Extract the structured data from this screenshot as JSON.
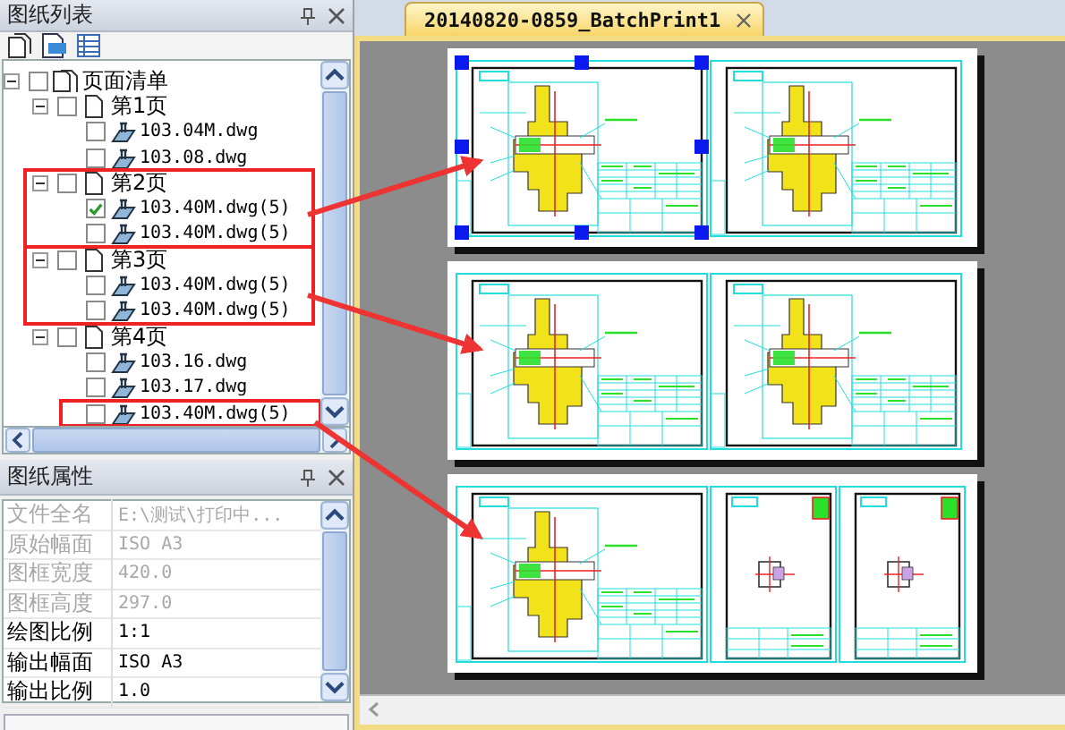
{
  "drawing_list_panel": {
    "title": "图纸列表",
    "tree": [
      {
        "label": "页面清单",
        "kind": "root",
        "expanded": true,
        "checked": false,
        "highlighted": false,
        "children": [
          {
            "label": "第1页",
            "kind": "page",
            "expanded": true,
            "checked": false,
            "highlighted": false,
            "children": [
              {
                "label": "103.04M.dwg",
                "kind": "file",
                "checked": false,
                "highlighted": false
              },
              {
                "label": "103.08.dwg",
                "kind": "file",
                "checked": false,
                "highlighted": false
              }
            ]
          },
          {
            "label": "第2页",
            "kind": "page",
            "expanded": true,
            "checked": false,
            "highlighted": true,
            "children": [
              {
                "label": "103.40M.dwg(5)",
                "kind": "file",
                "checked": true,
                "highlighted": false
              },
              {
                "label": "103.40M.dwg(5)",
                "kind": "file",
                "checked": false,
                "highlighted": false
              }
            ]
          },
          {
            "label": "第3页",
            "kind": "page",
            "expanded": true,
            "checked": false,
            "highlighted": true,
            "children": [
              {
                "label": "103.40M.dwg(5)",
                "kind": "file",
                "checked": false,
                "highlighted": false
              },
              {
                "label": "103.40M.dwg(5)",
                "kind": "file",
                "checked": false,
                "highlighted": false
              }
            ]
          },
          {
            "label": "第4页",
            "kind": "page",
            "expanded": true,
            "checked": false,
            "highlighted": false,
            "children": [
              {
                "label": "103.16.dwg",
                "kind": "file",
                "checked": false,
                "highlighted": false
              },
              {
                "label": "103.17.dwg",
                "kind": "file",
                "checked": false,
                "highlighted": false
              },
              {
                "label": "103.40M.dwg(5)",
                "kind": "file",
                "checked": false,
                "highlighted": true
              }
            ]
          }
        ]
      }
    ]
  },
  "properties_panel": {
    "title": "图纸属性",
    "rows": [
      {
        "label": "文件全名",
        "value": "E:\\测试\\打印中...",
        "disabled": true
      },
      {
        "label": "原始幅面",
        "value": "ISO A3",
        "disabled": true
      },
      {
        "label": "图框宽度",
        "value": "420.0",
        "disabled": true
      },
      {
        "label": "图框高度",
        "value": "297.0",
        "disabled": true
      },
      {
        "label": "绘图比例",
        "value": "1:1",
        "disabled": false
      },
      {
        "label": "输出幅面",
        "value": "ISO A3",
        "disabled": false
      },
      {
        "label": "输出比例",
        "value": "1.0",
        "disabled": false
      }
    ]
  },
  "document_tab": {
    "title": "20140820-0859_BatchPrint1",
    "selected": true
  },
  "sheets": [
    {
      "drawings": [
        {
          "kind": "assembly",
          "selected": true
        },
        {
          "kind": "assembly",
          "selected": false
        }
      ]
    },
    {
      "drawings": [
        {
          "kind": "assembly",
          "selected": false
        },
        {
          "kind": "assembly",
          "selected": false
        }
      ]
    },
    {
      "drawings": [
        {
          "kind": "assembly",
          "selected": false
        },
        {
          "kind": "part",
          "selected": false
        },
        {
          "kind": "part",
          "selected": false
        }
      ]
    }
  ]
}
